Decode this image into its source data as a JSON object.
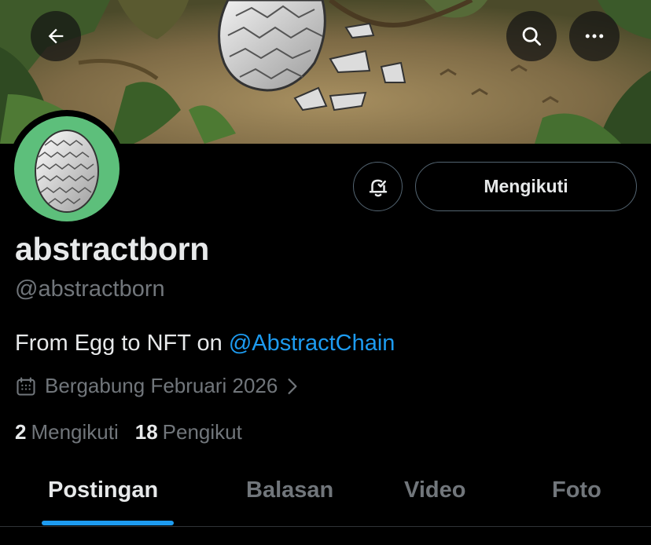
{
  "header": {
    "back_icon": "arrow-left-icon",
    "search_icon": "search-icon",
    "more_icon": "more-horizontal-icon"
  },
  "profile": {
    "display_name": "abstractborn",
    "handle": "@abstractborn",
    "bio_text": "From Egg to NFT on ",
    "bio_mention": "@AbstractChain",
    "joined": "Bergabung Februari 2026",
    "following_count": "2",
    "following_label": "Mengikuti",
    "followers_count": "18",
    "followers_label": "Pengikut"
  },
  "actions": {
    "notify_icon": "bell-check-icon",
    "follow_label": "Mengikuti"
  },
  "tabs": [
    {
      "label": "Postingan",
      "active": true
    },
    {
      "label": "Balasan",
      "active": false
    },
    {
      "label": "Video",
      "active": false
    },
    {
      "label": "Foto",
      "active": false
    }
  ],
  "colors": {
    "background": "#000000",
    "text_primary": "#e7e9ea",
    "text_secondary": "#71767b",
    "accent": "#1d9bf0",
    "avatar_bg": "#5dbf7b"
  }
}
